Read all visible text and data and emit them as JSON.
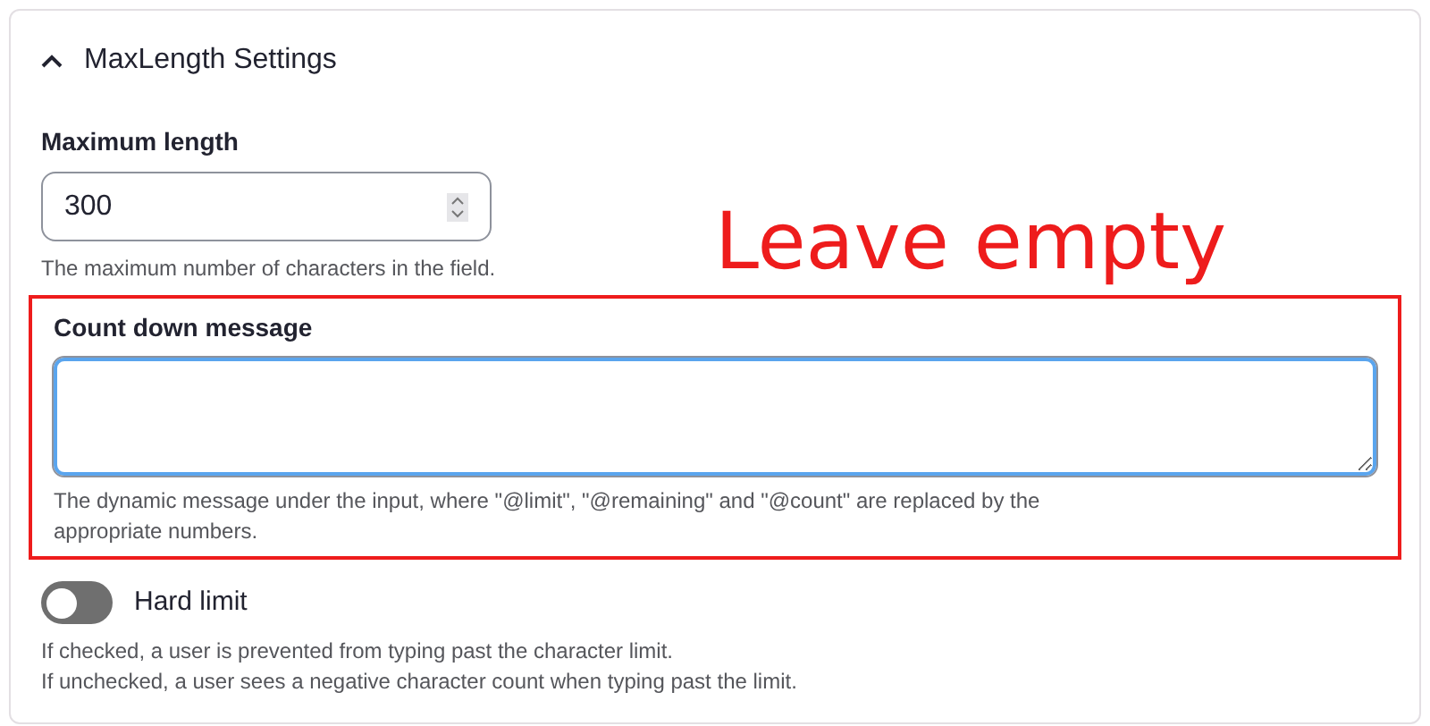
{
  "section": {
    "title": "MaxLength Settings",
    "expanded": true
  },
  "maximum_length": {
    "label": "Maximum length",
    "value": "300",
    "description": "The maximum number of characters in the field."
  },
  "annotation": {
    "text": "Leave empty"
  },
  "count_down_message": {
    "label": "Count down message",
    "description": "The dynamic message under the input, where \"@limit\", \"@remaining\" and \"@count\" are replaced by the appropriate numbers.",
    "highlighted": true
  },
  "hard_limit": {
    "label": "Hard limit",
    "on": false,
    "description_lines": [
      "If checked, a user is prevented from typing past the character limit.",
      "If unchecked, a user sees a negative character count when typing past the limit."
    ]
  }
}
